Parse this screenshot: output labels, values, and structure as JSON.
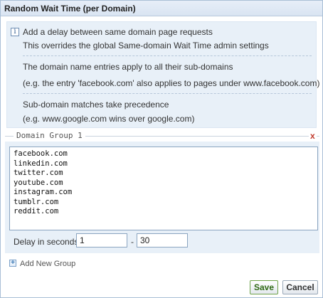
{
  "dialog": {
    "title": "Random Wait Time (per Domain)"
  },
  "info": {
    "icon": "info-icon",
    "lines": [
      "Add a delay between same domain page requests",
      "This overrides the global Same-domain Wait Time admin settings",
      "The domain name entries apply to all their sub-domains",
      "(e.g. the entry 'facebook.com' also applies to pages under www.facebook.com)",
      "Sub-domain matches take precedence",
      "(e.g. www.google.com wins over google.com)"
    ]
  },
  "group": {
    "legend": "Domain Group 1",
    "close_label": "x",
    "domains_text": "facebook.com\nlinkedin.com\ntwitter.com\nyoutube.com\ninstagram.com\ntumblr.com\nreddit.com",
    "delay_label": "Delay in seconds:",
    "delay_min": "1",
    "delay_separator": "-",
    "delay_max": "30"
  },
  "add_group": {
    "icon": "plus-icon",
    "label": "Add New Group"
  },
  "buttons": {
    "save": "Save",
    "cancel": "Cancel"
  }
}
